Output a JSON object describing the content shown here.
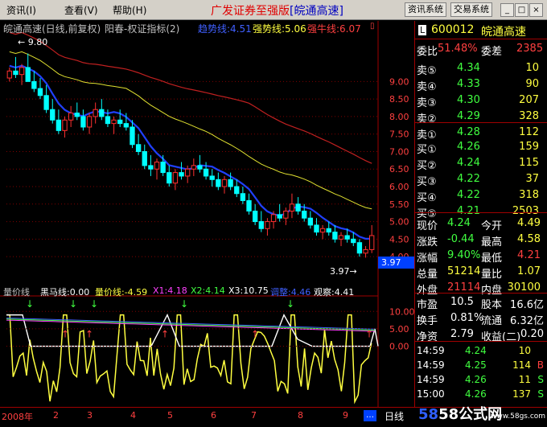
{
  "menu": {
    "items": [
      "资讯(I)",
      "查看(V)",
      "帮助(H)"
    ],
    "title": "广发证券至强版",
    "title2": "[皖通高速]",
    "buttons": [
      "资讯系统",
      "交易系统"
    ]
  },
  "chart_header": {
    "name": "皖通高速(日线,前复权)",
    "indicator_name": "阳春-权证指标(2)",
    "line1": "趋势线:4.51",
    "line2": "强势线:5.06",
    "line3": "强牛线:6.07"
  },
  "chart_data": [
    {
      "type": "candlestick",
      "y_ticks": [
        "9.00",
        "8.50",
        "8.00",
        "7.50",
        "7.00",
        "6.50",
        "6.00",
        "5.50",
        "5.00",
        "4.50",
        "4.00"
      ],
      "ylim": [
        3.75,
        9.95
      ],
      "high_label": "9.80",
      "low_label": "3.97",
      "current_price_label": "3.97",
      "candles": [
        [
          9.1,
          9.4,
          9.0,
          9.3
        ],
        [
          9.3,
          9.7,
          9.1,
          9.2
        ],
        [
          9.2,
          9.5,
          8.9,
          9.4
        ],
        [
          9.4,
          9.8,
          9.2,
          9.0
        ],
        [
          9.0,
          9.3,
          8.7,
          8.8
        ],
        [
          8.8,
          9.1,
          8.5,
          8.6
        ],
        [
          8.6,
          8.9,
          8.1,
          8.2
        ],
        [
          8.2,
          8.5,
          7.8,
          7.9
        ],
        [
          7.9,
          8.2,
          7.5,
          7.6
        ],
        [
          7.6,
          8.0,
          7.4,
          7.9
        ],
        [
          7.9,
          8.3,
          7.7,
          8.1
        ],
        [
          8.1,
          8.4,
          7.9,
          8.0
        ],
        [
          8.0,
          8.2,
          7.6,
          7.7
        ],
        [
          7.7,
          8.1,
          7.5,
          8.0
        ],
        [
          8.0,
          8.4,
          7.8,
          8.2
        ],
        [
          8.2,
          8.5,
          7.9,
          8.0
        ],
        [
          8.0,
          8.2,
          7.7,
          7.8
        ],
        [
          7.8,
          8.0,
          7.5,
          7.9
        ],
        [
          7.9,
          8.2,
          7.7,
          7.8
        ],
        [
          7.8,
          8.1,
          7.6,
          7.7
        ],
        [
          7.7,
          7.9,
          7.1,
          7.2
        ],
        [
          7.2,
          7.5,
          6.9,
          7.0
        ],
        [
          7.0,
          7.2,
          6.5,
          6.6
        ],
        [
          6.6,
          6.9,
          6.3,
          6.5
        ],
        [
          6.5,
          6.8,
          6.2,
          6.7
        ],
        [
          6.7,
          6.9,
          6.3,
          6.4
        ],
        [
          6.4,
          6.6,
          6.0,
          6.1
        ],
        [
          6.1,
          6.5,
          5.9,
          6.4
        ],
        [
          6.4,
          6.7,
          6.2,
          6.3
        ],
        [
          6.3,
          6.6,
          6.1,
          6.5
        ],
        [
          6.5,
          6.8,
          6.3,
          6.6
        ],
        [
          6.6,
          6.9,
          6.4,
          6.5
        ],
        [
          6.5,
          6.7,
          6.2,
          6.3
        ],
        [
          6.3,
          6.5,
          6.0,
          6.2
        ],
        [
          6.2,
          6.4,
          5.9,
          6.0
        ],
        [
          6.0,
          6.3,
          5.8,
          6.2
        ],
        [
          6.2,
          6.4,
          5.9,
          6.0
        ],
        [
          6.0,
          6.2,
          5.7,
          5.8
        ],
        [
          5.8,
          6.0,
          5.5,
          5.6
        ],
        [
          5.6,
          5.8,
          5.2,
          5.3
        ],
        [
          5.3,
          5.5,
          4.9,
          5.0
        ],
        [
          5.0,
          5.3,
          4.7,
          4.8
        ],
        [
          4.8,
          5.1,
          4.6,
          5.0
        ],
        [
          5.0,
          5.3,
          4.8,
          5.2
        ],
        [
          5.2,
          5.5,
          5.0,
          5.1
        ],
        [
          5.1,
          5.4,
          4.9,
          5.3
        ],
        [
          5.3,
          5.8,
          5.1,
          5.5
        ],
        [
          5.5,
          5.7,
          5.2,
          5.3
        ],
        [
          5.3,
          5.5,
          5.0,
          5.1
        ],
        [
          5.1,
          5.3,
          4.8,
          4.9
        ],
        [
          4.9,
          5.1,
          4.6,
          4.7
        ],
        [
          4.7,
          4.9,
          4.5,
          4.8
        ],
        [
          4.8,
          5.0,
          4.6,
          4.7
        ],
        [
          4.7,
          4.9,
          4.4,
          4.5
        ],
        [
          4.5,
          4.7,
          4.3,
          4.6
        ],
        [
          4.6,
          4.8,
          4.4,
          4.5
        ],
        [
          4.5,
          4.7,
          4.3,
          4.4
        ],
        [
          4.4,
          4.5,
          4.0,
          4.1
        ],
        [
          4.1,
          4.3,
          3.97,
          4.2
        ],
        [
          4.2,
          4.9,
          4.1,
          4.6
        ]
      ]
    },
    {
      "type": "line",
      "y_ticks": [
        "10.00",
        "5.00",
        "0.00"
      ],
      "ylim": [
        -17,
        14
      ]
    }
  ],
  "indicator_header": {
    "label": "量价线",
    "black": "黑马线:0.00",
    "qj": "量价线:-4.59",
    "x1": "X1:4.18",
    "x2": "X2:4.14",
    "x3": "X3:10.75",
    "mm": "调整:4.46",
    "obs": "观察:4.41"
  },
  "panel": {
    "code": "600012",
    "name": "皖通高速",
    "weibi_label": "委比",
    "weibi": "51.48%",
    "weicha_label": "委差",
    "weicha": "2385",
    "sells": [
      {
        "label": "卖⑤",
        "price": "4.34",
        "vol": "10"
      },
      {
        "label": "卖④",
        "price": "4.33",
        "vol": "90"
      },
      {
        "label": "卖③",
        "price": "4.30",
        "vol": "207"
      },
      {
        "label": "卖②",
        "price": "4.29",
        "vol": "328"
      },
      {
        "label": "卖①",
        "price": "4.28",
        "vol": "112"
      }
    ],
    "buys": [
      {
        "label": "买①",
        "price": "4.26",
        "vol": "159"
      },
      {
        "label": "买②",
        "price": "4.24",
        "vol": "115"
      },
      {
        "label": "买③",
        "price": "4.22",
        "vol": "37"
      },
      {
        "label": "买④",
        "price": "4.22",
        "vol": "318"
      },
      {
        "label": "买⑤",
        "price": "4.21",
        "vol": "2503"
      }
    ],
    "quotes": [
      {
        "l1": "现价",
        "v1": "4.24",
        "l2": "今开",
        "v2": "4.49"
      },
      {
        "l1": "涨跌",
        "v1": "-0.44",
        "l2": "最高",
        "v2": "4.58"
      },
      {
        "l1": "涨幅",
        "v1": "9.40%",
        "l2": "最低",
        "v2": "4.21"
      },
      {
        "l1": "总量",
        "v1": "51214",
        "l2": "量比",
        "v2": "1.07"
      },
      {
        "l1": "外盘",
        "v1": "21114",
        "l2": "内盘",
        "v2": "30100"
      }
    ],
    "stats": [
      {
        "l1": "市盈",
        "v1": "10.5",
        "l2": "股本",
        "v2": "16.6亿"
      },
      {
        "l1": "换手",
        "v1": "0.81%",
        "l2": "流通",
        "v2": "6.32亿"
      },
      {
        "l1": "净资",
        "v1": "2.79",
        "l2": "收益(二)",
        "v2": "0.20"
      }
    ],
    "ticks": [
      {
        "time": "14:59",
        "price": "4.24",
        "vol": "10",
        "flag": ""
      },
      {
        "time": "14:59",
        "price": "4.25",
        "vol": "114",
        "flag": "B"
      },
      {
        "time": "14:59",
        "price": "4.26",
        "vol": "11",
        "flag": "S"
      },
      {
        "time": "15:00",
        "price": "4.26",
        "vol": "137",
        "flag": "S"
      }
    ]
  },
  "bottom": {
    "dates": [
      "2008年",
      "2",
      "3",
      "4",
      "5",
      "6",
      "7",
      "8",
      "9"
    ],
    "period": "日线",
    "watermark": "58公式网",
    "watermark_url": "www.58gs.com"
  },
  "colors": {
    "up": "#ff3030",
    "down": "#00ffff",
    "blue_ma": "#2040ff",
    "yellow_ma": "#e0e030",
    "red_ma": "#c02020",
    "grid": "#800000"
  }
}
